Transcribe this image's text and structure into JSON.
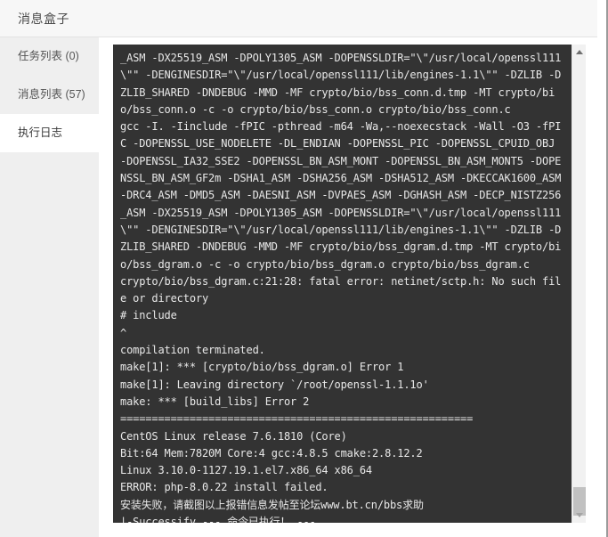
{
  "header": {
    "title": "消息盒子"
  },
  "sidebar": {
    "items": [
      {
        "label": "任务列表 (0)",
        "name": "task-list",
        "active": false
      },
      {
        "label": "消息列表 (57)",
        "name": "message-list",
        "active": false
      },
      {
        "label": "执行日志",
        "name": "execution-log",
        "active": true
      }
    ]
  },
  "log": {
    "lines": [
      "_ASM -DX25519_ASM -DPOLY1305_ASM -DOPENSSLDIR=\"\\\"/usr/local/openssl111",
      "\\\"\" -DENGINESDIR=\"\\\"/usr/local/openssl111/lib/engines-1.1\\\"\" -DZLIB -D",
      "ZLIB_SHARED -DNDEBUG -MMD -MF crypto/bio/bss_conn.d.tmp -MT crypto/bi",
      "o/bss_conn.o -c -o crypto/bio/bss_conn.o crypto/bio/bss_conn.c",
      "gcc -I. -Iinclude -fPIC -pthread -m64 -Wa,--noexecstack -Wall -O3 -fPI",
      "C -DOPENSSL_USE_NODELETE -DL_ENDIAN -DOPENSSL_PIC -DOPENSSL_CPUID_OBJ",
      "-DOPENSSL_IA32_SSE2 -DOPENSSL_BN_ASM_MONT -DOPENSSL_BN_ASM_MONT5 -DOPE",
      "NSSL_BN_ASM_GF2m -DSHA1_ASM -DSHA256_ASM -DSHA512_ASM -DKECCAK1600_ASM",
      "-DRC4_ASM -DMD5_ASM -DAESNI_ASM -DVPAES_ASM -DGHASH_ASM -DECP_NISTZ256",
      "_ASM -DX25519_ASM -DPOLY1305_ASM -DOPENSSLDIR=\"\\\"/usr/local/openssl111",
      "\\\"\" -DENGINESDIR=\"\\\"/usr/local/openssl111/lib/engines-1.1\\\"\" -DZLIB -D",
      "ZLIB_SHARED -DNDEBUG -MMD -MF crypto/bio/bss_dgram.d.tmp -MT crypto/bi",
      "o/bss_dgram.o -c -o crypto/bio/bss_dgram.o crypto/bio/bss_dgram.c",
      "crypto/bio/bss_dgram.c:21:28: fatal error: netinet/sctp.h: No such fil",
      "e or directory",
      "# include",
      "^",
      "compilation terminated.",
      "make[1]: *** [crypto/bio/bss_dgram.o] Error 1",
      "make[1]: Leaving directory `/root/openssl-1.1.1o'",
      "make: *** [build_libs] Error 2",
      "========================================================",
      "CentOS Linux release 7.6.1810 (Core)",
      "Bit:64 Mem:7820M Core:4 gcc:4.8.5 cmake:2.8.12.2",
      "Linux 3.10.0-1127.19.1.el7.x86_64 x86_64",
      "ERROR: php-8.0.22 install failed.",
      "安装失败，请截图以上报错信息发帖至论坛www.bt.cn/bbs求助",
      "|-Successify --- 命令已执行！ ---"
    ]
  },
  "scrollbar": {
    "up_arrow": "scroll-up",
    "down_arrow": "scroll-down",
    "thumb": "scroll-thumb"
  },
  "colors": {
    "panel_background": "#333333",
    "log_text": "#e8e8e8",
    "sidebar_background": "#efefef",
    "header_background": "#f7f7f7",
    "scrollbar_thumb": "#c1c1c1"
  }
}
